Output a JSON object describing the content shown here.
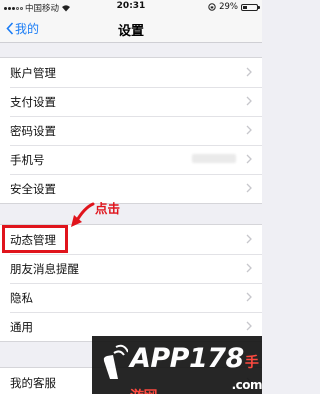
{
  "status_bar": {
    "carrier": "中国移动",
    "wifi_icon": "wifi-icon",
    "time": "20:31",
    "lock_icon": "rotation-lock-icon",
    "battery": "29%",
    "battery_level": 0.29
  },
  "nav": {
    "back_label": "我的",
    "title": "设置"
  },
  "groups": [
    {
      "items": [
        {
          "label": "账户管理"
        },
        {
          "label": "支付设置"
        },
        {
          "label": "密码设置"
        },
        {
          "label": "手机号",
          "value_hidden": true
        },
        {
          "label": "安全设置"
        }
      ]
    },
    {
      "items": [
        {
          "label": "动态管理"
        },
        {
          "label": "朋友消息提醒"
        },
        {
          "label": "隐私"
        },
        {
          "label": "通用"
        }
      ]
    },
    {
      "items": [
        {
          "label": "我的客服"
        }
      ]
    }
  ],
  "annotation": {
    "text": "点击",
    "color": "#e0141c"
  },
  "watermark": {
    "brand": "APP178",
    "suffix": "手游网",
    "domain": ".com"
  },
  "colors": {
    "accent": "#1a7cf5",
    "background": "#efeff4",
    "annotation": "#e0141c"
  }
}
